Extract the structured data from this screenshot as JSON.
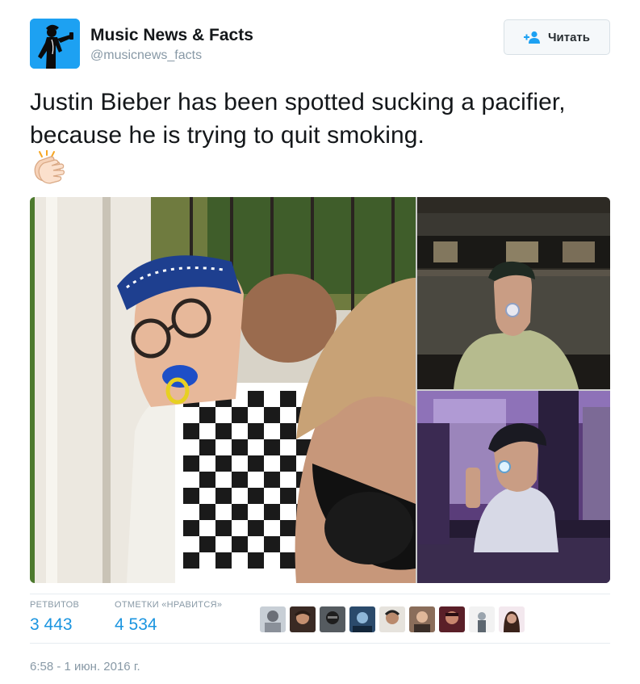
{
  "author": {
    "name": "Music News & Facts",
    "handle": "@musicnews_facts"
  },
  "follow_button": {
    "label": "Читать",
    "icon": "follow-person-plus-icon"
  },
  "tweet": {
    "text": "Justin Bieber has been spotted sucking a pacifier, because he is trying to quit smoking.",
    "emoji": "clapping-hands-emoji"
  },
  "stats": {
    "retweets_label": "РЕТВИТОВ",
    "retweets_value": "3 443",
    "likes_label": "ОТМЕТКИ «НРАВИТСЯ»",
    "likes_value": "4 534"
  },
  "likers": [
    {
      "icon": "liker-avatar-1"
    },
    {
      "icon": "liker-avatar-2"
    },
    {
      "icon": "liker-avatar-3"
    },
    {
      "icon": "liker-avatar-4"
    },
    {
      "icon": "liker-avatar-5"
    },
    {
      "icon": "liker-avatar-6"
    },
    {
      "icon": "liker-avatar-7"
    },
    {
      "icon": "liker-avatar-8"
    },
    {
      "icon": "liker-avatar-9"
    }
  ],
  "timestamp": "6:58 - 1 июн. 2016 г.",
  "colors": {
    "link_blue": "#1b95e0",
    "secondary_text": "#8899a6",
    "avatar_blue": "#1da1f2"
  }
}
